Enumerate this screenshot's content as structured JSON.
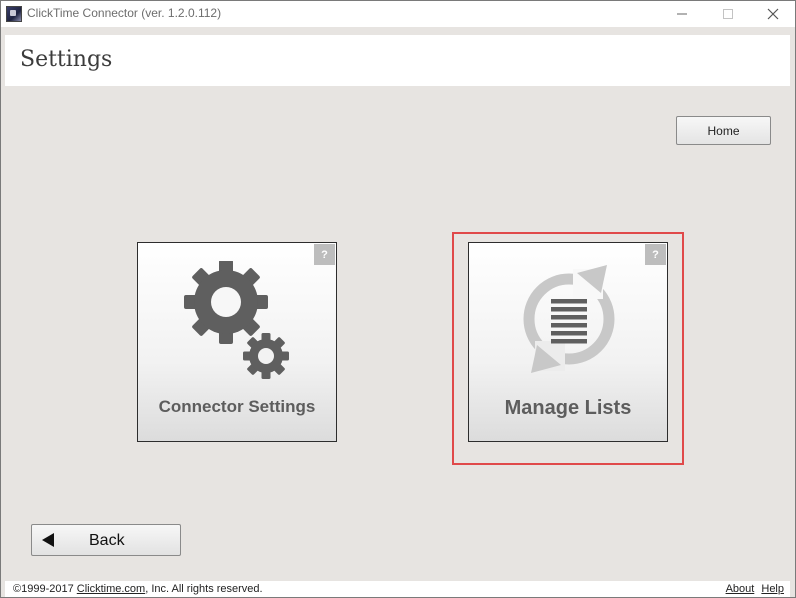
{
  "window": {
    "title": "ClickTime Connector (ver. 1.2.0.112)",
    "controls": {
      "minimize": "—",
      "maximize": "☐",
      "close": "✕"
    }
  },
  "header": {
    "title": "Settings"
  },
  "nav": {
    "home_label": "Home",
    "back_label": "Back"
  },
  "tiles": [
    {
      "label": "Connector Settings",
      "help": "?",
      "icon": "gears-icon"
    },
    {
      "label": "Manage Lists",
      "help": "?",
      "icon": "sync-list-icon",
      "selected": true
    }
  ],
  "footer": {
    "copyright_prefix": "©1999-2017 ",
    "copyright_link": "Clicktime.com",
    "copyright_suffix": ", Inc. All rights reserved.",
    "about": "About",
    "help": "Help"
  },
  "colors": {
    "background": "#e7e4e1",
    "selection": "#e0494a",
    "icon_dark": "#5f5f5f",
    "icon_light": "#c8c8c8"
  }
}
